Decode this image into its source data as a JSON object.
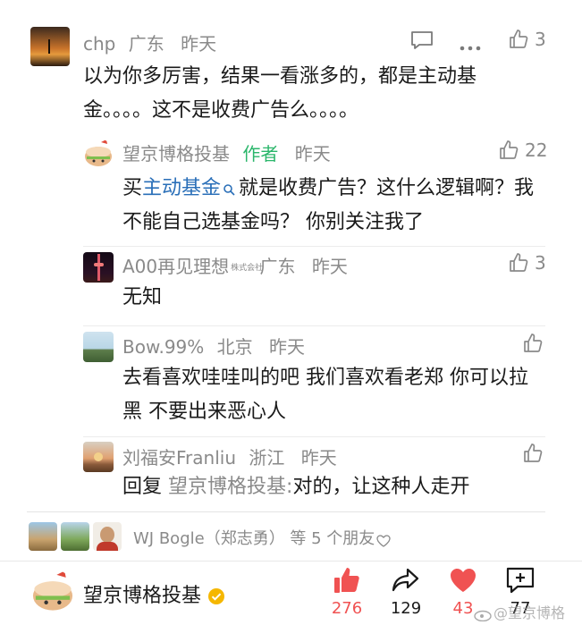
{
  "comment": {
    "user": "chp",
    "location": "广东",
    "time": "昨天",
    "likes": "3",
    "text_line1": "以为你多厉害，结果一看涨多的，都是主动基",
    "text_line2": "金。。。。这不是收费广告么。。。。"
  },
  "replies": [
    {
      "user": "望京博格投基",
      "badge": "作者",
      "time": "昨天",
      "likes": "22",
      "prefix": "买",
      "link": "主动基金",
      "text_rest": "就是收费广告？这什么逻辑啊？我",
      "text_line2": "不能自己选基金吗？ 你别关注我了"
    },
    {
      "user": "A00再见理想",
      "user_badge": "株式会社",
      "location": "广东",
      "time": "昨天",
      "likes": "3",
      "text": "无知"
    },
    {
      "user": "Bow.99%",
      "location": "北京",
      "time": "昨天",
      "text_line1": "去看喜欢哇哇叫的吧 我们喜欢看老郑 你可以拉",
      "text_line2": "黑 不要出来恶心人"
    },
    {
      "user": "刘福安Franliu",
      "location": "浙江",
      "time": "昨天",
      "reply_prefix": "回复",
      "reply_to": "望京博格投基:",
      "text": "对的，让这种人走开"
    }
  ],
  "friends": {
    "text": "WJ Bogle（郑志勇） 等 5 个朋友"
  },
  "footer": {
    "account": "望京博格投基",
    "like_count": "276",
    "share_count": "129",
    "heart_count": "43",
    "comment_count": "77",
    "watermark": "@望京博格"
  },
  "colors": {
    "accent_red": "#f05252",
    "author_green": "#2bb66b",
    "link_blue": "#2a6fb8",
    "meta_gray": "#8a8a8a"
  }
}
